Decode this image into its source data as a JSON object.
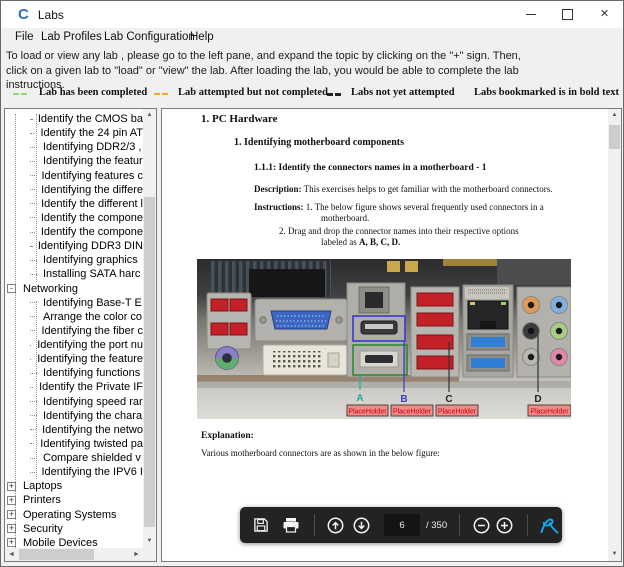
{
  "window": {
    "title": "Labs",
    "logo": "C"
  },
  "menu": {
    "items": [
      "File",
      "Lab Profiles",
      "Lab Configuration",
      "Help"
    ]
  },
  "instructions": "To load or view any lab , please go to the left pane, and expand the topic by clicking on the \"+\" sign. Then, click on a given lab to \"load\" or \"view\" the lab.  After loading the lab, you would be able to complete the lab instructions.",
  "legend": {
    "items": [
      {
        "label": "Lab has been completed",
        "dash_color": "#8ed973"
      },
      {
        "label": "Lab attempted but not completed",
        "dash_color": "#f5a33b"
      },
      {
        "label": "Labs not yet  attempted",
        "dash_color": "#222222"
      }
    ],
    "note": "Labs bookmarked is in bold text"
  },
  "tree": {
    "items": [
      {
        "label": "Identify the CMOS ba",
        "type": "leaf"
      },
      {
        "label": "Identify the 24 pin AT",
        "type": "leaf"
      },
      {
        "label": "Identifying DDR2/3 ,",
        "type": "leaf"
      },
      {
        "label": "Identifying the featur",
        "type": "leaf"
      },
      {
        "label": "Identifying features c",
        "type": "leaf"
      },
      {
        "label": "Identifying the differe",
        "type": "leaf"
      },
      {
        "label": "Identify the different l",
        "type": "leaf"
      },
      {
        "label": "Identify the compone",
        "type": "leaf"
      },
      {
        "label": "Identify the compone",
        "type": "leaf"
      },
      {
        "label": "Identifying DDR3 DIN",
        "type": "leaf"
      },
      {
        "label": "Identifying graphics",
        "type": "leaf"
      },
      {
        "label": "Installing SATA harc",
        "type": "leaf"
      },
      {
        "label": "Networking",
        "type": "expanded"
      },
      {
        "label": "Identifying Base-T E",
        "type": "leaf"
      },
      {
        "label": "Arrange the color co",
        "type": "leaf"
      },
      {
        "label": "Identifying the fiber c",
        "type": "leaf"
      },
      {
        "label": "Identifying the port nu",
        "type": "leaf"
      },
      {
        "label": "Identifying the feature",
        "type": "leaf"
      },
      {
        "label": "Identifying functions",
        "type": "leaf"
      },
      {
        "label": "Identify the Private IF",
        "type": "leaf"
      },
      {
        "label": "Identifying speed rar",
        "type": "leaf"
      },
      {
        "label": "Identifying the chara",
        "type": "leaf"
      },
      {
        "label": "Identifying the netwo",
        "type": "leaf"
      },
      {
        "label": "Identifying twisted pa",
        "type": "leaf"
      },
      {
        "label": "Compare shielded v",
        "type": "leaf"
      },
      {
        "label": "Identifying the IPV6 I",
        "type": "leaf"
      },
      {
        "label": "Laptops",
        "type": "collapsed"
      },
      {
        "label": "Printers",
        "type": "collapsed"
      },
      {
        "label": "Operating Systems",
        "type": "collapsed"
      },
      {
        "label": "Security",
        "type": "collapsed"
      },
      {
        "label": "Mobile Devices",
        "type": "collapsed"
      }
    ]
  },
  "document": {
    "h1": "1. PC Hardware",
    "h2": "1. Identifying motherboard components",
    "h3": "1.1.1: Identify the connectors names in a motherboard - 1",
    "description_label": "Description:",
    "description": " This exercises helps to get familiar with the motherboard connectors.",
    "instructions_label": "Instructions:",
    "instruction1": " 1. The  below figure shows several frequently used connectors in a",
    "instruction1_cont": "motherboard.",
    "instruction2": "2. Drag and drop the connector names into their respective options",
    "instruction2_cont": "labeled as ",
    "instruction2_bold": "A, B, C, D.",
    "explanation_label": "Explanation:",
    "explanation": "Various motherboard connectors are as shown in the below figure:"
  },
  "figure": {
    "labels": [
      {
        "text": "A",
        "color": "#18b29a"
      },
      {
        "text": "B",
        "color": "#3a3ace"
      },
      {
        "text": "C",
        "color": "#222222"
      },
      {
        "text": "D",
        "color": "#222222"
      }
    ],
    "placeholders": [
      "PlaceHolder",
      "PlaceHolder",
      "PlaceHolder",
      "PlaceHolder"
    ],
    "colors": {
      "placeholder_bg": "#f28b82",
      "placeholder_text": "#c00020",
      "box_a_outline": "#2e8b2e",
      "box_b_outline": "#3a3ace"
    }
  },
  "pdf_toolbar": {
    "page_current": "6",
    "page_total": "/ 350",
    "icons": [
      "save-icon",
      "print-icon",
      "page-up-icon",
      "page-down-icon",
      "zoom-out-icon",
      "zoom-in-icon",
      "adobe-acrobat-icon"
    ],
    "colors": {
      "toolbar_bg": "#232323",
      "adobe_blue": "#1ba3e8"
    }
  }
}
